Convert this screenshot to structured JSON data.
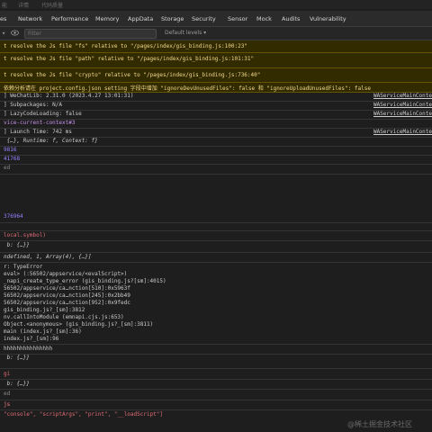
{
  "top_strip": [
    "能",
    "详情",
    "代码质量"
  ],
  "tabs": [
    "es",
    "Network",
    "Performance",
    "Memory",
    "AppData",
    "Storage",
    "Security",
    "Sensor",
    "Mock",
    "Audits",
    "Vulnerability"
  ],
  "toolbar": {
    "filter_placeholder": "Filter",
    "levels_label": "Default levels ▾"
  },
  "console": [
    {
      "text": "t resolve the Js file \"fs\" relative to \"/pages/index/gis_binding.js:100:23\""
    },
    {
      "text": "t resolve the Js file \"path\" relative to \"/pages/index/gis_binding.js:101:31\""
    },
    {
      "text": "t resolve the Js file \"crypto\" relative to \"/pages/index/gis_binding.js:736:40\""
    },
    {
      "text": "依赖分析请在 project.config.json setting 字段中增加 \"ignoreDevUnusedFiles\": false 和 \"ignoreUploadUnusedFiles\": false"
    },
    {
      "text": "] WeChatLib: 2.31.0 (2023.4.27 13:01:31)",
      "source": "WAServiceMainConte"
    },
    {
      "text": "] Subpackages: N/A",
      "source": "WAServiceMainConte"
    },
    {
      "text": "] LazyCodeLoading: false",
      "source": "WAServiceMainConte"
    },
    {
      "text": "vice-current-context#3"
    },
    {
      "text": "] Launch Time: 742 ms",
      "source": "WAServiceMainConte"
    },
    {
      "text": " {…}, Runtime: f, Context: f}"
    },
    {
      "text": "9816"
    },
    {
      "text": "41768"
    },
    {
      "text": "ed"
    },
    {
      "text": "376964"
    },
    {
      "text": "local.symbol)"
    },
    {
      "text": " b: {…}}"
    },
    {
      "text": "ndefined, 1, Array(4), {…}]"
    },
    {
      "text": "r: TypeError"
    },
    {
      "text": "eval> (:56502/appservice/<evalScript>)"
    },
    {
      "text": "_napi_create_type_error (gis_binding.js?[sm]:4015)"
    },
    {
      "text": "56502/appservice/ca…nction[510]:0x5963f"
    },
    {
      "text": "56502/appservice/ca…nction[245]:0x2bb49"
    },
    {
      "text": "56502/appservice/ca…nction[952]:0x9fedc"
    },
    {
      "text": "gis_binding.js?_[sm]:3812"
    },
    {
      "text": "nv.callIntoModule (emnapi.cjs.js:653)"
    },
    {
      "text": "Object.<anonymous> (gis_binding.js?_[sm]:3811)"
    },
    {
      "text": "main (index.js?_[sm]:36)"
    },
    {
      "text": "index.js?_[sm]:96"
    },
    {
      "text": "hhhhhhhhhhhhhhh"
    },
    {
      "text": " b: {…}}"
    },
    {
      "text": "gi"
    },
    {
      "text": " b: {…}}"
    },
    {
      "text": "ed"
    },
    {
      "text": "js"
    },
    {
      "text": "\"console\", \"scriptArgs\", \"print\", \"__loadScript\"]"
    }
  ],
  "watermark": "@稀土掘金技术社区"
}
